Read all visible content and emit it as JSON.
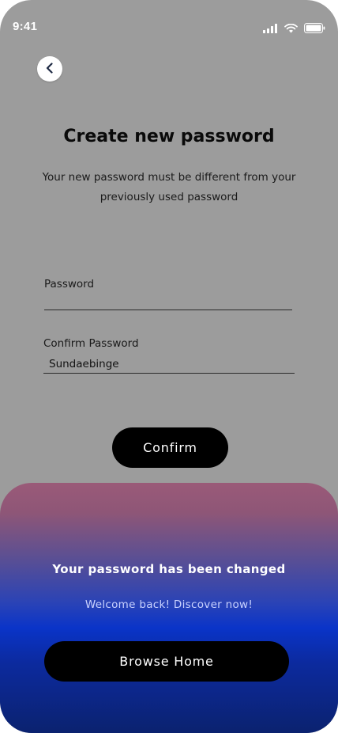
{
  "status_bar": {
    "time": "9:41",
    "icons": [
      "cellular-signal-icon",
      "wifi-icon",
      "battery-icon"
    ]
  },
  "header": {
    "back_icon": "chevron-left-icon"
  },
  "main": {
    "title": "Create new password",
    "subtitle": "Your new password must be different from your previously used password",
    "password_field": {
      "label": "Password",
      "value": ""
    },
    "confirm_password_field": {
      "label": "Confirm Password",
      "value": "Sundaebinge"
    },
    "confirm_button_label": "Confirm"
  },
  "success_sheet": {
    "title": "Your password has been changed",
    "subtitle": "Welcome back! Discover now!",
    "browse_button_label": "Browse Home"
  },
  "colors": {
    "overlay_background": "#9c9c9c",
    "button_background": "#000000",
    "sheet_gradient_top": "#9a5a78",
    "sheet_gradient_middle": "#0a34c8",
    "sheet_gradient_bottom": "#0b226f"
  }
}
